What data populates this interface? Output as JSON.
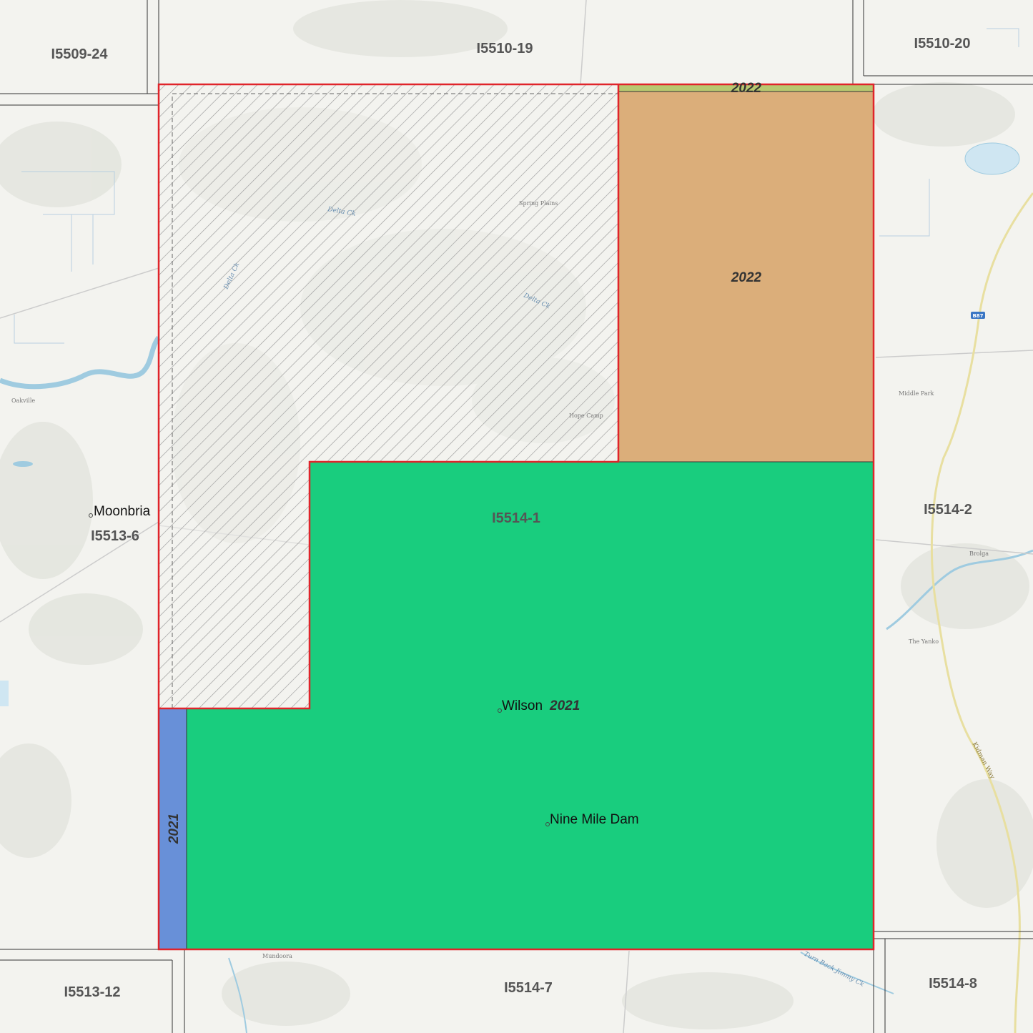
{
  "colors": {
    "base": "#f3f3ef",
    "grid_line": "#333333",
    "selection_outline": "#e0242a",
    "lot_2022": "#dbae7a",
    "lot_2021_main": "#19cd7e",
    "lot_2021_strip": "#6890d8",
    "hatch": "#9a9a9a",
    "water": "#9fcbe0"
  },
  "grid_cells": [
    {
      "id": "I5509-24",
      "label": "I5509-24"
    },
    {
      "id": "I5510-19",
      "label": "I5510-19"
    },
    {
      "id": "I5510-20",
      "label": "I5510-20"
    },
    {
      "id": "I5513-6",
      "label": "I5513-6"
    },
    {
      "id": "I5514-1",
      "label": "I5514-1"
    },
    {
      "id": "I5514-2",
      "label": "I5514-2"
    },
    {
      "id": "I5513-12",
      "label": "I5513-12"
    },
    {
      "id": "I5514-7",
      "label": "I5514-7"
    },
    {
      "id": "I5514-8",
      "label": "I5514-8"
    }
  ],
  "parcels": {
    "orange_top_strip": {
      "year": "2022"
    },
    "orange_main": {
      "year": "2022"
    },
    "green_main": {
      "year": "2021"
    },
    "blue_strip": {
      "year": "2021"
    }
  },
  "places": {
    "moonbria": "Moonbria",
    "wilson": "Wilson",
    "nine_mile_dam": "Nine Mile Dam"
  },
  "basemap_labels": {
    "oakville": "Oakville",
    "middle_park": "Middle Park",
    "the_yanko": "The Yanko",
    "mundoora": "Mundoora",
    "spring_plains": "Spring Plains",
    "hope_camp": "Hope Camp",
    "brolga": "Brolga",
    "delta_ck_1": "Delta Ck",
    "delta_ck_2": "Delta Ck",
    "delta_ck_3": "Delta Ck",
    "turn_back_jimmy_ck": "Turn Back Jimmy Ck",
    "kidman_way": "Kidman Way",
    "road_shield": "B87"
  }
}
